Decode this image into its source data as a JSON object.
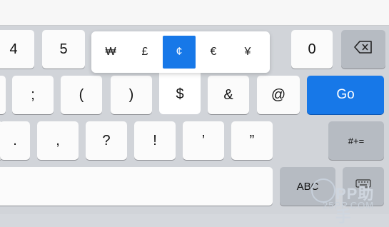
{
  "keyboard": {
    "row1": [
      "4",
      "5",
      "0"
    ],
    "currency_options": [
      "₩",
      "£",
      "¢",
      "€",
      "¥"
    ],
    "currency_selected": "¢",
    "popup_key": "$",
    "row2": [
      ";",
      "(",
      ")",
      "&",
      "@"
    ],
    "go_label": "Go",
    "row3": [
      ".",
      ",",
      "?",
      "!",
      "’",
      "”"
    ],
    "more_symbols_label": "#+=",
    "abc_label": "ABC",
    "accent_color": "#1778e8"
  },
  "watermark": {
    "brand": "PP助手",
    "site": "25PP.COM"
  }
}
